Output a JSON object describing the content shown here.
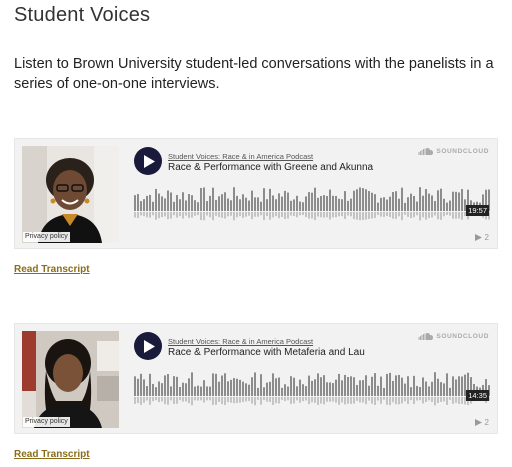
{
  "page": {
    "title": "Student Voices",
    "intro": "Listen to Brown University student-led conversations with the panelists in a series of one-on-one interviews."
  },
  "players": [
    {
      "uploader": "Student Voices: Race & in America Podcast",
      "track_title": "Race & Performance with Greene and Akunna",
      "duration": "19:57",
      "play_count": "2",
      "privacy_label": "Privacy policy",
      "brand": "SOUNDCLOUD",
      "artwork_icon": "portrait-woman-glasses"
    },
    {
      "uploader": "Student Voices: Race & in America Podcast",
      "track_title": "Race & Performance with Metaferia and Lau",
      "duration": "14:35",
      "play_count": "2",
      "privacy_label": "Privacy policy",
      "brand": "SOUNDCLOUD",
      "artwork_icon": "portrait-woman"
    }
  ],
  "links": {
    "transcript_1": "Read Transcript",
    "transcript_2": "Read Transcript"
  },
  "colors": {
    "link": "#8a6d1b",
    "play_button": "#1a1a3a",
    "waveform": "#8c8c8c",
    "embed_bg": "#f2f2f2"
  }
}
